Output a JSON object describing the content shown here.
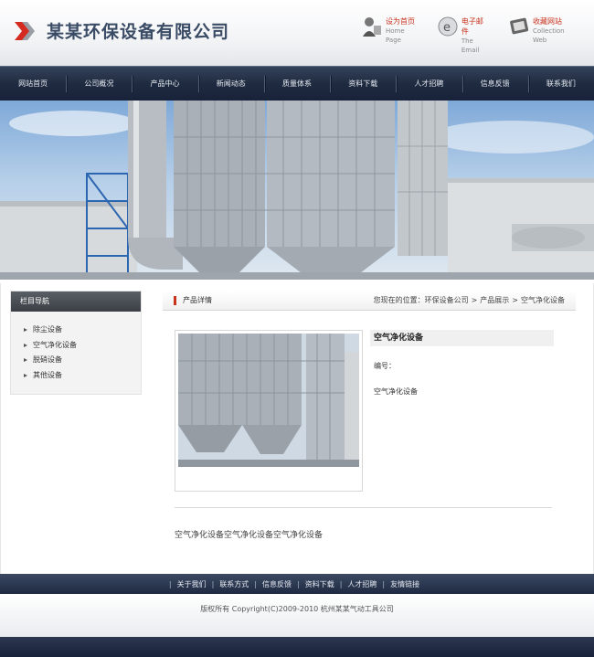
{
  "header": {
    "company_name": "某某环保设备有限公司",
    "links": [
      {
        "cn": "设为首页",
        "en": "Home Page",
        "icon": "home-icon"
      },
      {
        "cn": "电子邮件",
        "en": "The Email",
        "icon": "email-icon"
      },
      {
        "cn": "收藏网站",
        "en": "Collection Web",
        "icon": "bookmark-icon"
      }
    ]
  },
  "nav": {
    "items": [
      "网站首页",
      "公司概况",
      "产品中心",
      "新闻动态",
      "质量体系",
      "资料下载",
      "人才招聘",
      "信息反馈",
      "联系我们"
    ]
  },
  "sidebar": {
    "title": "栏目导航",
    "items": [
      "除尘设备",
      "空气净化设备",
      "脱硝设备",
      "其他设备"
    ]
  },
  "main": {
    "page_title": "产品详情",
    "breadcrumb": {
      "prefix": "您现在的位置：",
      "items": [
        "环保设备公司",
        "产品展示",
        "空气净化设备"
      ],
      "separator": ">"
    },
    "product": {
      "name": "空气净化设备",
      "number_label": "编号：",
      "short_desc": "空气净化设备",
      "description": "空气净化设备空气净化设备空气净化设备"
    }
  },
  "footer": {
    "links": [
      "关于我们",
      "联系方式",
      "信息反馈",
      "资料下载",
      "人才招聘",
      "友情链接"
    ],
    "separator": "|",
    "copyright": "版权所有  Copyright(C)2009-2010 杭州某某气动工具公司"
  },
  "colors": {
    "nav_bg": "#1f2b40",
    "logo_text": "#3a4b66",
    "accent_red": "#c8331e"
  }
}
